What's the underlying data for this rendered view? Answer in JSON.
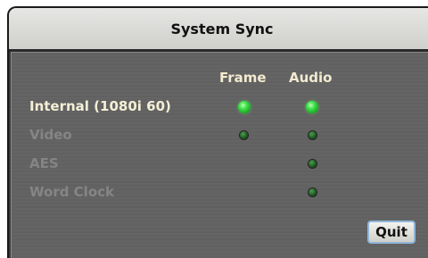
{
  "window": {
    "title": "System Sync"
  },
  "columns": {
    "frame": "Frame",
    "audio": "Audio"
  },
  "rows": [
    {
      "label": "Internal (1080i 60)",
      "active": true,
      "frame": "on",
      "audio": "on"
    },
    {
      "label": "Video",
      "active": false,
      "frame": "off",
      "audio": "off"
    },
    {
      "label": "AES",
      "active": false,
      "frame": null,
      "audio": "off"
    },
    {
      "label": "Word Clock",
      "active": false,
      "frame": null,
      "audio": "off"
    }
  ],
  "buttons": {
    "quit": "Quit"
  },
  "colors": {
    "led_on": "#3ee04a",
    "led_off": "#1d5a22",
    "active_text": "#f4efd6",
    "inactive_text": "#858585",
    "panel_bg": "#646464",
    "titlebar_bg": "#dcdcda"
  }
}
